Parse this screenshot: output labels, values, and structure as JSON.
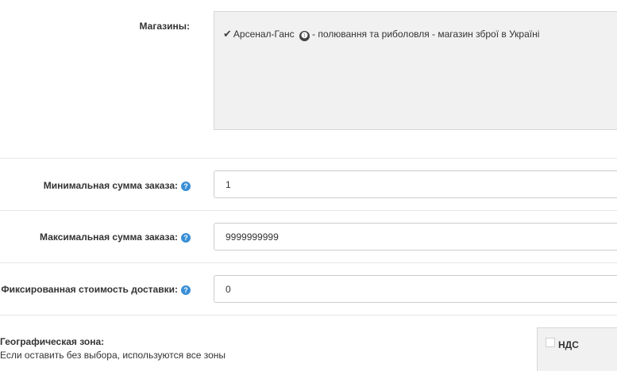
{
  "stores": {
    "label": "Магазины:",
    "items": [
      {
        "checked": true,
        "name": "Арсенал-Ганс",
        "info_icon": "❶",
        "description": "- полювання та риболовля - магазин зброї в Україні"
      }
    ]
  },
  "min_order": {
    "label": "Минимальная сумма заказа:",
    "value": "1"
  },
  "max_order": {
    "label": "Максимальная сумма заказа:",
    "value": "9999999999"
  },
  "fixed_delivery": {
    "label": "Фиксированная стоимость доставки:",
    "value": "0"
  },
  "geo_zone": {
    "label": "Географическая зона:",
    "hint": "Если оставить без выбора, используются все зоны",
    "options": [
      {
        "label": "НДС",
        "checked": false
      }
    ]
  },
  "help_icon_glyph": "?",
  "colors": {
    "help_icon": "#3a8fd6",
    "panel_bg": "#f1f1f1",
    "border": "#cccccc"
  }
}
